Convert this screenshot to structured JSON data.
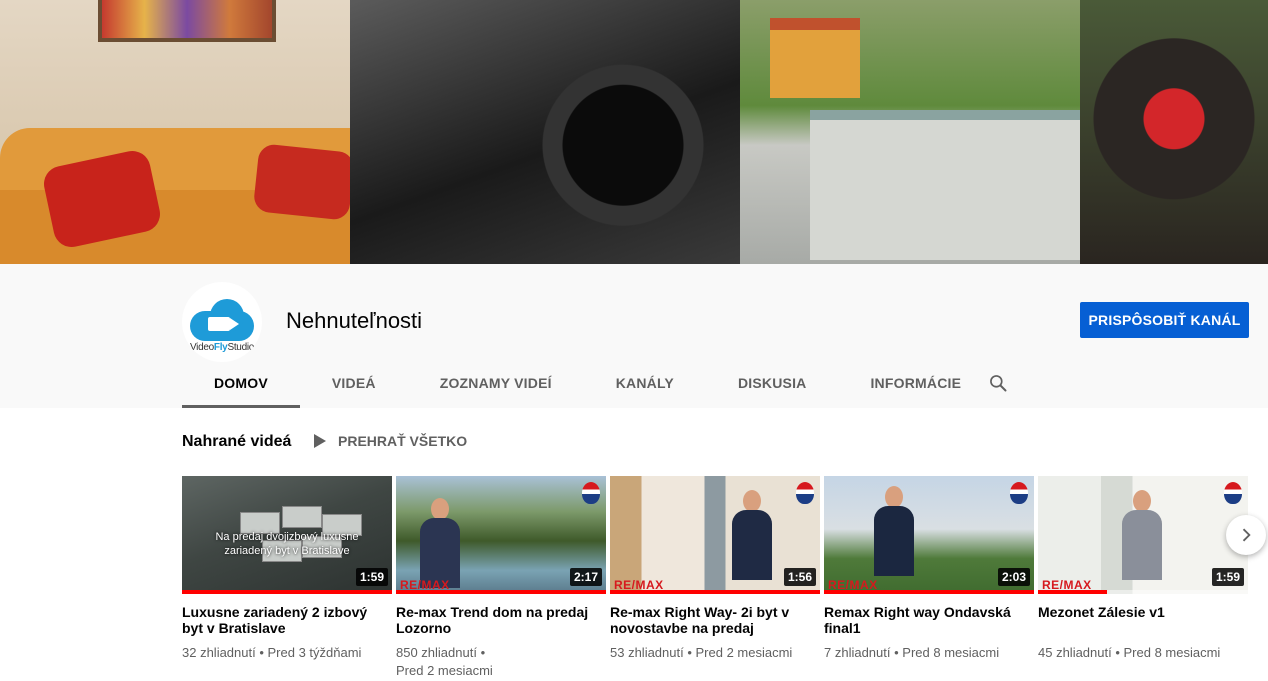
{
  "channel": {
    "name": "Nehnuteľnosti",
    "avatar_brand_part1": "Video",
    "avatar_brand_part2": "Fly",
    "avatar_brand_part3": "Studio",
    "customize_label": "PRISPÔSOBIŤ KANÁL"
  },
  "tabs": [
    {
      "label": "DOMOV",
      "active": true
    },
    {
      "label": "VIDEÁ",
      "active": false
    },
    {
      "label": "ZOZNAMY VIDEÍ",
      "active": false
    },
    {
      "label": "KANÁLY",
      "active": false
    },
    {
      "label": "DISKUSIA",
      "active": false
    },
    {
      "label": "INFORMÁCIE",
      "active": false
    }
  ],
  "section": {
    "title": "Nahrané videá",
    "play_all_label": "PREHRAŤ VŠETKO"
  },
  "videos": [
    {
      "title": "Luxusne zariadený 2 izbový byt v Bratislave",
      "views": "32 zhliadnutí",
      "age": "Pred 3 týždňami",
      "duration": "1:59",
      "overlay": "Na predaj dvojizbový luxusne zariadený byt v Bratislave",
      "watched_fraction": 1.0,
      "remax": ""
    },
    {
      "title": "Re-max Trend dom na predaj Lozorno",
      "views": "850 zhliadnutí",
      "age": "Pred 2 mesiacmi",
      "duration": "2:17",
      "overlay": "",
      "watched_fraction": 1.0,
      "remax": "RE/MAX"
    },
    {
      "title": "Re-max Right Way- 2i byt v novostavbe na predaj",
      "views": "53 zhliadnutí",
      "age": "Pred 2 mesiacmi",
      "duration": "1:56",
      "overlay": "",
      "watched_fraction": 1.0,
      "remax": "RE/MAX"
    },
    {
      "title": "Remax Right way Ondavská final1",
      "views": "7 zhliadnutí",
      "age": "Pred 8 mesiacmi",
      "duration": "2:03",
      "overlay": "",
      "watched_fraction": 1.0,
      "remax": "RE/MAX"
    },
    {
      "title": "Mezonet Zálesie v1",
      "views": "45 zhliadnutí",
      "age": "Pred 8 mesiacmi",
      "duration": "1:59",
      "overlay": "",
      "watched_fraction": 0.33,
      "remax": "RE/MAX"
    }
  ],
  "colors": {
    "accent_blue": "#065fd4",
    "progress_red": "#ff0000",
    "brand_cloud": "#1e9bd8"
  },
  "icons": {
    "search": "search-icon",
    "play": "play-icon",
    "next": "chevron-right-icon"
  }
}
